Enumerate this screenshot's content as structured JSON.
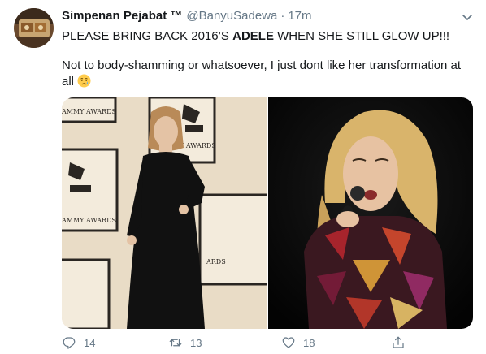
{
  "tweet": {
    "display_name": "Simpenan Pejabat ™",
    "handle": "@BanyuSadewa",
    "separator": "·",
    "time": "17m",
    "text_line1_before": "PLEASE BRING BACK 2016’S ",
    "text_line1_bold": "ADELE",
    "text_line1_after": " WHEN SHE STILL GLOW UP!!!",
    "text_line2": "Not to body-shamming or whatsoever, I just dont like her transformation at all",
    "text_line2_emoji": "crying-face-emoji"
  },
  "media": {
    "photo1": {
      "icon": "photo",
      "backdrop_labels": [
        "AMMY AWARDS",
        "Y AWARDS",
        "AMMY AWARDS",
        "ARDS"
      ]
    },
    "photo2": {
      "icon": "photo"
    }
  },
  "actions": {
    "reply_count": "14",
    "retweet_count": "13",
    "like_count": "18"
  },
  "colors": {
    "text": "#14171a",
    "secondary": "#657786",
    "background": "#ffffff"
  }
}
